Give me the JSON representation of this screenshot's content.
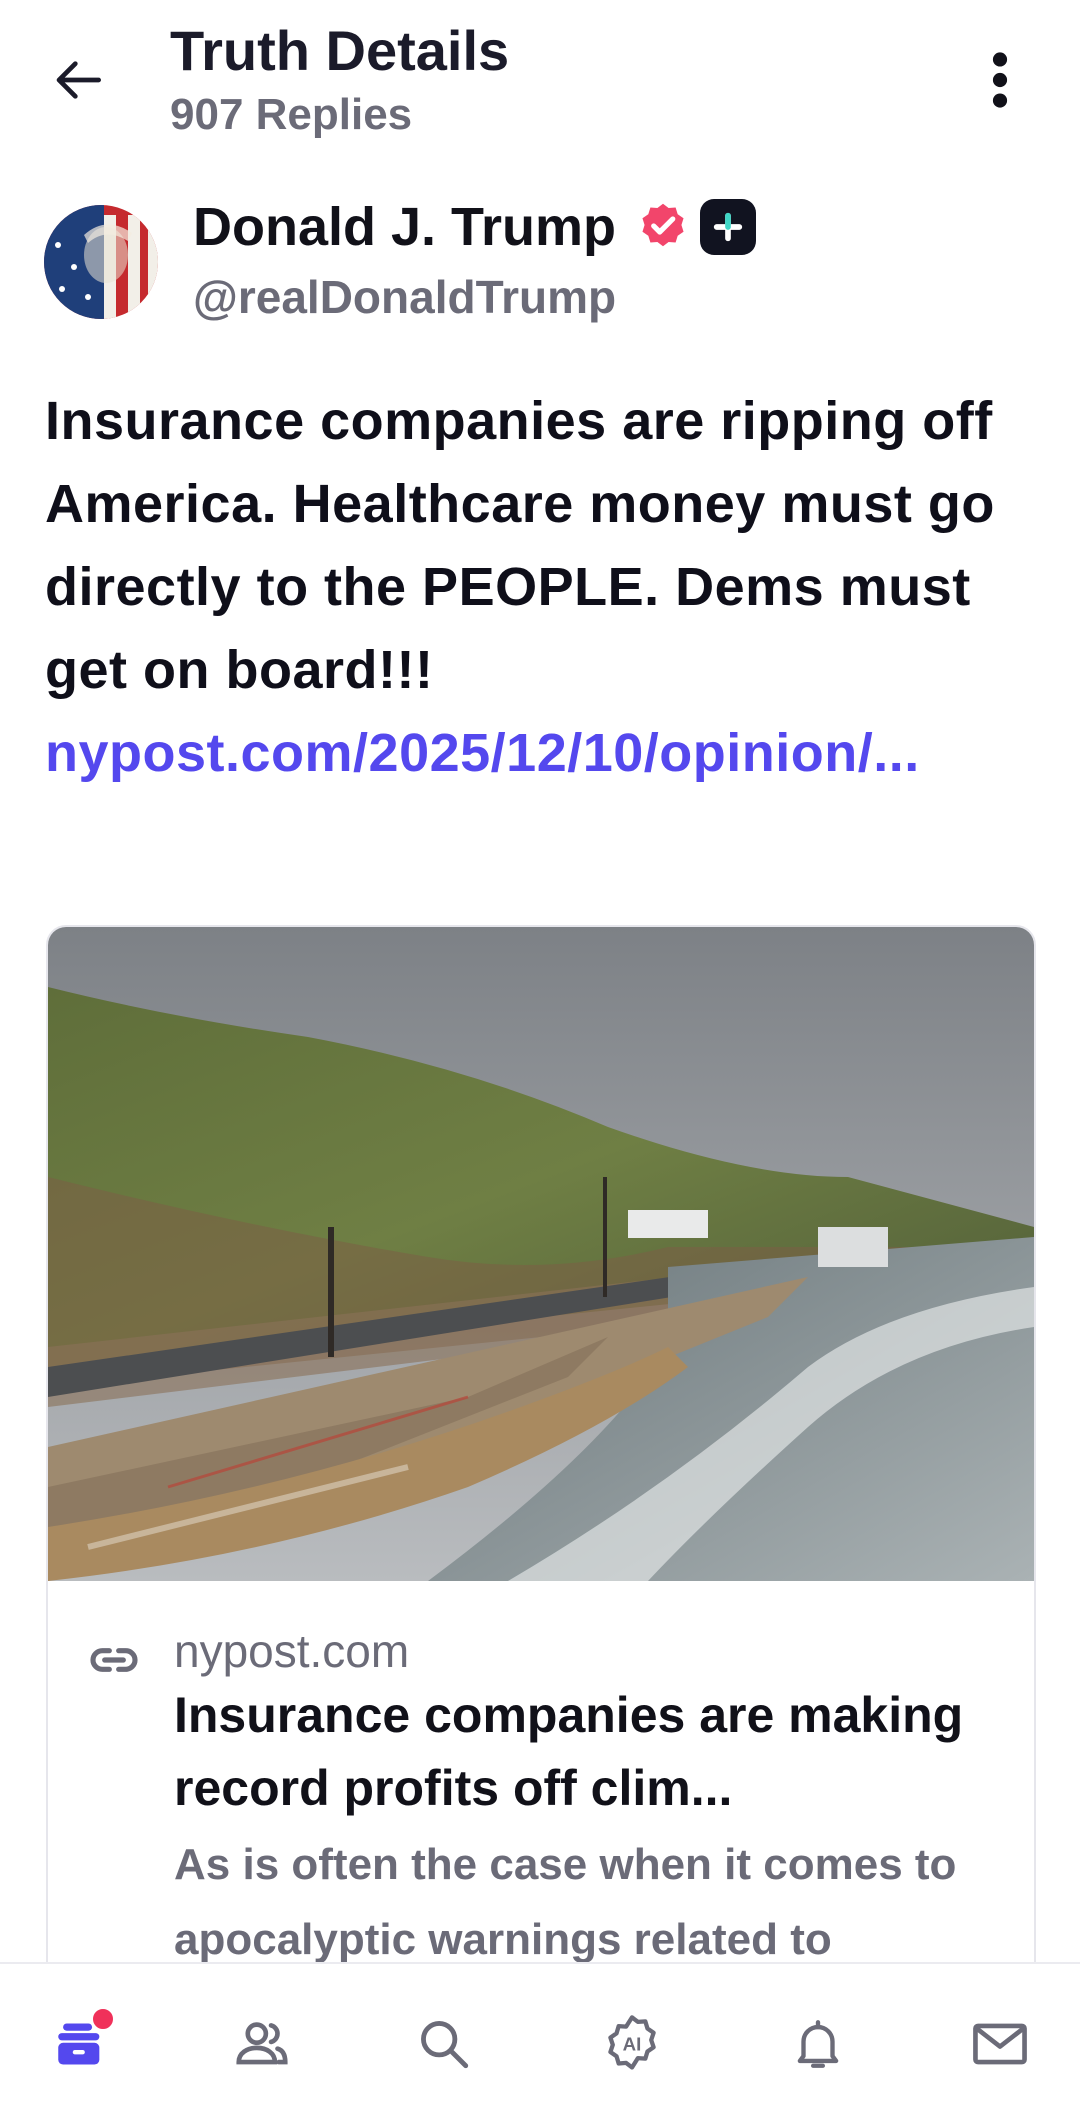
{
  "header": {
    "title": "Truth Details",
    "subtitle": "907 Replies",
    "back_icon": "arrow-left-icon",
    "more_icon": "kebab-menu-icon"
  },
  "author": {
    "name": "Donald J. Trump",
    "handle": "@realDonaldTrump",
    "verified_color": "#f2456b",
    "plus_badge_color": "#111320"
  },
  "post": {
    "text": "Insurance companies are ripping off America. Healthcare money must go directly to the PEOPLE. Dems must get on board!!!",
    "link": "nypost.com/2025/12/10/opinion/...",
    "link_color": "#5448ee"
  },
  "link_card": {
    "domain": "nypost.com",
    "title": "Insurance companies are making record profits off clim...",
    "description": "As is often the case when it comes to apocalyptic warnings related to"
  },
  "bottom_nav": {
    "items": [
      {
        "name": "home",
        "icon": "home-feed-icon",
        "active": true,
        "badge": true
      },
      {
        "name": "groups",
        "icon": "users-icon"
      },
      {
        "name": "search",
        "icon": "search-icon"
      },
      {
        "name": "ai",
        "icon": "ai-badge-icon",
        "label": "AI"
      },
      {
        "name": "notifications",
        "icon": "bell-icon"
      },
      {
        "name": "messages",
        "icon": "mail-icon"
      }
    ],
    "active_color": "#5448ee",
    "badge_color": "#f0315a"
  }
}
